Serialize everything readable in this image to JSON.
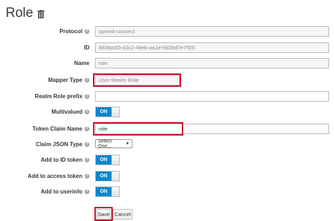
{
  "header": {
    "title": "Role"
  },
  "form": {
    "protocol": {
      "label": "Protocol",
      "value": "openid-connect"
    },
    "id": {
      "label": "ID",
      "value": "8938a0f3-d3c2-48eb-aa1e-5b26d7e7ff25"
    },
    "name": {
      "label": "Name",
      "value": "role"
    },
    "mapper_type": {
      "label": "Mapper Type",
      "value": "User Realm Role"
    },
    "realm_role_prefix": {
      "label": "Realm Role prefix",
      "value": ""
    },
    "multivalued": {
      "label": "Multivalued",
      "toggle": "ON"
    },
    "token_claim_name": {
      "label": "Token Claim Name",
      "value": "role"
    },
    "claim_json_type": {
      "label": "Claim JSON Type",
      "value": "Select One..."
    },
    "add_to_id_token": {
      "label": "Add to ID token",
      "toggle": "ON"
    },
    "add_to_access_token": {
      "label": "Add to access token",
      "toggle": "ON"
    },
    "add_to_userinfo": {
      "label": "Add to userinfo",
      "toggle": "ON"
    }
  },
  "actions": {
    "save_label": "Save",
    "cancel_label": "Cancel"
  },
  "colors": {
    "toggle_on": "#0088ce",
    "highlight": "#c8102e"
  },
  "icons": {
    "delete": "trash-icon",
    "help": "help-icon"
  }
}
